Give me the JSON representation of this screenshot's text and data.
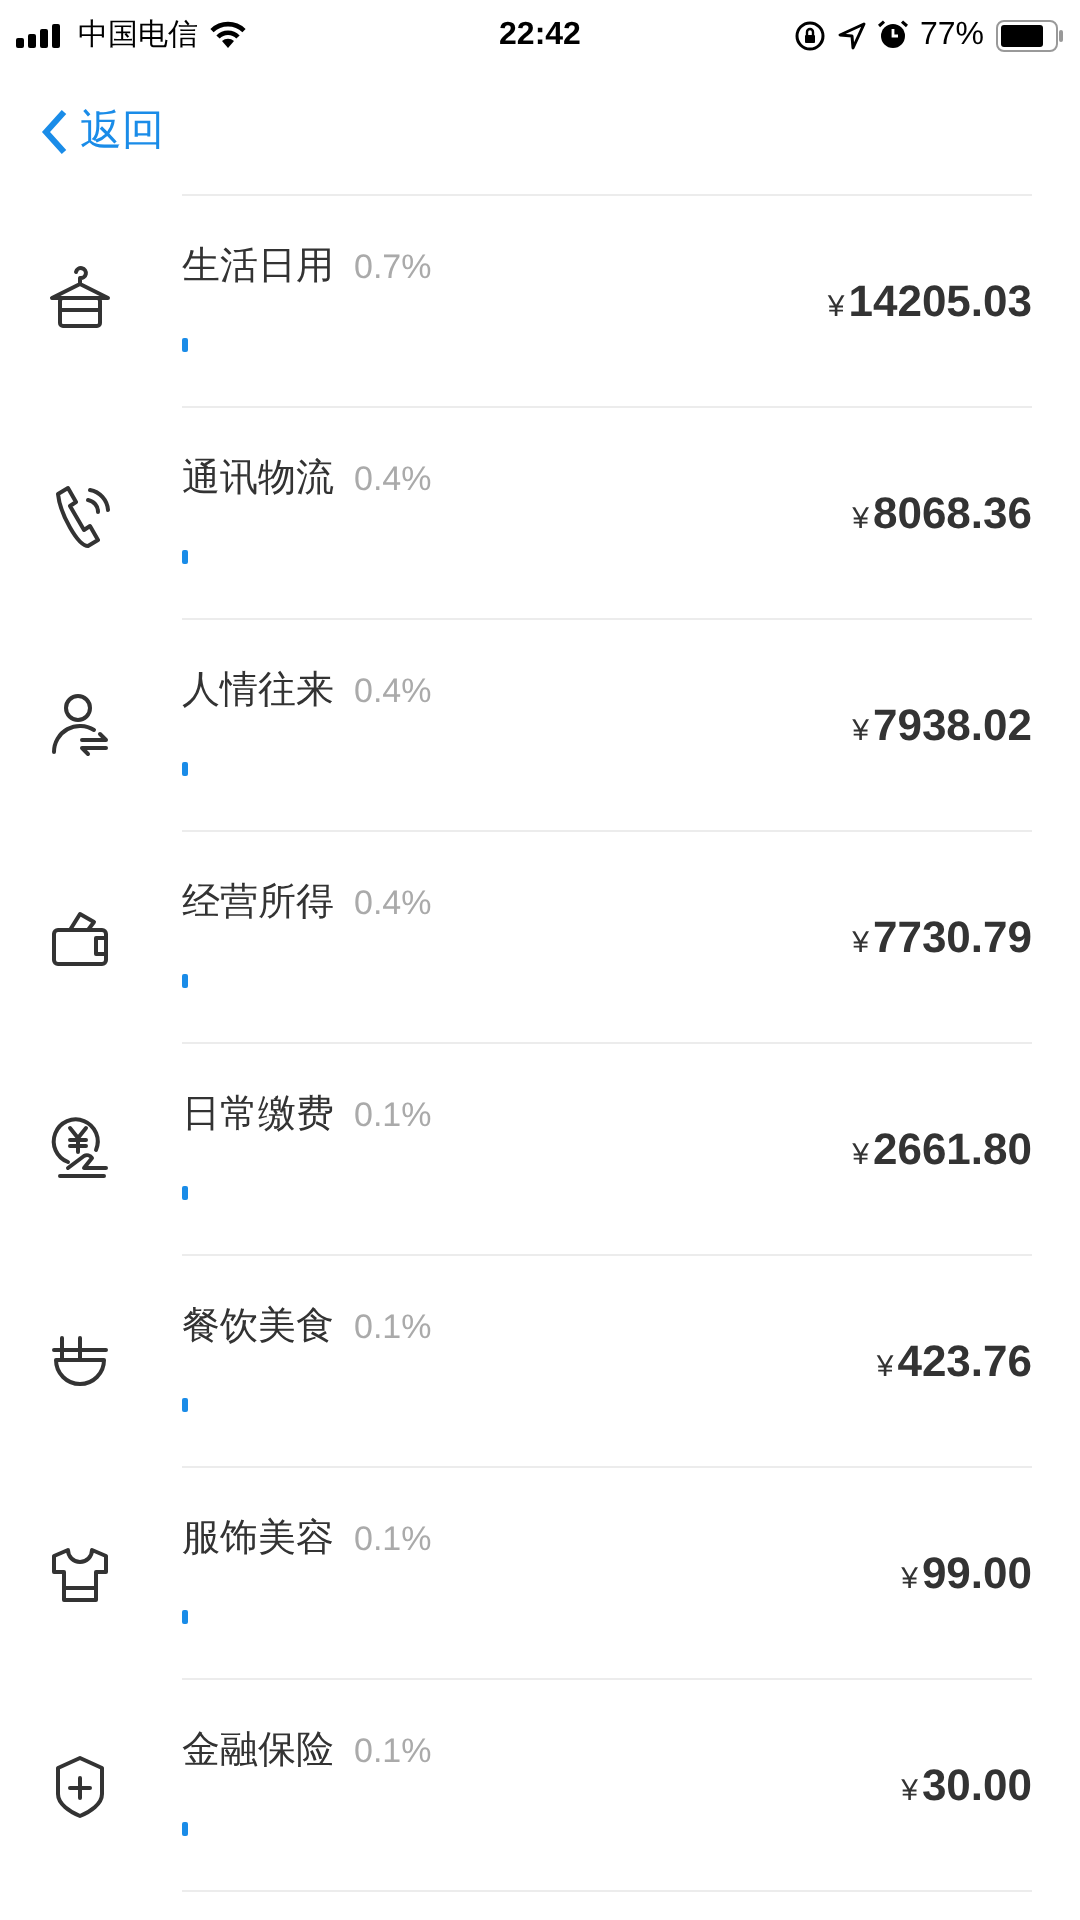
{
  "status_bar": {
    "carrier": "中国电信",
    "time": "22:42",
    "battery": "77%"
  },
  "nav": {
    "back": "返回"
  },
  "items": [
    {
      "kind": "hanger",
      "name": "生活日用",
      "percent": "0.7%",
      "level": 0.007,
      "currency": "¥",
      "amount": "14205.03"
    },
    {
      "kind": "phone",
      "name": "通讯物流",
      "percent": "0.4%",
      "level": 0.004,
      "currency": "¥",
      "amount": "8068.36"
    },
    {
      "kind": "person",
      "name": "人情往来",
      "percent": "0.4%",
      "level": 0.004,
      "currency": "¥",
      "amount": "7938.02"
    },
    {
      "kind": "wallet",
      "name": "经营所得",
      "percent": "0.4%",
      "level": 0.004,
      "currency": "¥",
      "amount": "7730.79"
    },
    {
      "kind": "coin-hand",
      "name": "日常缴费",
      "percent": "0.1%",
      "level": 0.001,
      "currency": "¥",
      "amount": "2661.80"
    },
    {
      "kind": "bowl",
      "name": "餐饮美食",
      "percent": "0.1%",
      "level": 0.001,
      "currency": "¥",
      "amount": "423.76"
    },
    {
      "kind": "shirt",
      "name": "服饰美容",
      "percent": "0.1%",
      "level": 0.001,
      "currency": "¥",
      "amount": "99.00"
    },
    {
      "kind": "shield",
      "name": "金融保险",
      "percent": "0.1%",
      "level": 0.001,
      "currency": "¥",
      "amount": "30.00"
    }
  ]
}
